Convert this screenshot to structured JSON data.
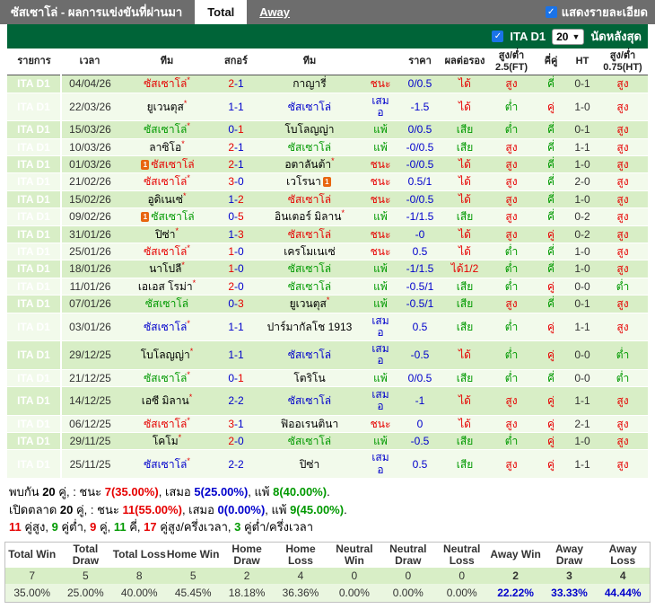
{
  "topbar": {
    "title": "ซัสเซาโล่ - ผลการแข่งขันที่ผ่านมา",
    "tabs": [
      {
        "label": "Total",
        "active": true
      },
      {
        "label": "Away",
        "active": false
      }
    ],
    "details_label": "แสดงรายละเอียด",
    "details_checked": true
  },
  "filter": {
    "league_label": "ITA D1",
    "league_checked": true,
    "match_count": "20",
    "last_matches_label": "นัดหลังสุด"
  },
  "colors": {
    "red": "#e60000",
    "blue": "#0000cc",
    "green": "#009900",
    "league_blue": "#1b7ad6",
    "bar_green": "#006438",
    "row_dark": "#d8eec6",
    "row_light": "#f2faeb",
    "topbar_gray": "#6d6d6d"
  },
  "table": {
    "headers": [
      "รายการ",
      "เวลา",
      "ทีม",
      "สกอร์",
      "ทีม",
      "",
      "ราคา",
      "ผลต่อรอง",
      "สูง/ต่ำ 2.5(FT)",
      "คี่คู่",
      "HT",
      "สูง/ต่ำ 0.75(HT)"
    ],
    "rows": [
      {
        "lg": "ITA D1",
        "dt": "04/04/26",
        "h": {
          "n": "ซัสเซาโล่",
          "c": "r",
          "s": 1
        },
        "sc": {
          "h": "2",
          "a": "1",
          "w": "h"
        },
        "a": {
          "n": "กาญารี่",
          "c": "k"
        },
        "res": {
          "t": "ชนะ",
          "c": "r"
        },
        "hdp": "0/0.5",
        "od": {
          "t": "ได้",
          "c": "r"
        },
        "ou": {
          "t": "สูง",
          "c": "r"
        },
        "oe": {
          "t": "คี่",
          "c": "g"
        },
        "ht": "0-1",
        "ou2": {
          "t": "สูง",
          "c": "r"
        }
      },
      {
        "lg": "ITA D1",
        "dt": "22/03/26",
        "h": {
          "n": "ยูเวนตุส",
          "c": "k",
          "s": 1
        },
        "sc": {
          "h": "1",
          "a": "1",
          "w": "d"
        },
        "a": {
          "n": "ซัสเซาโล่",
          "c": "b"
        },
        "res": {
          "t": "เสมอ",
          "c": "b"
        },
        "hdp": "-1.5",
        "od": {
          "t": "ได้",
          "c": "r"
        },
        "ou": {
          "t": "ต่ำ",
          "c": "g"
        },
        "oe": {
          "t": "คู่",
          "c": "r"
        },
        "ht": "1-0",
        "ou2": {
          "t": "สูง",
          "c": "r"
        }
      },
      {
        "lg": "ITA D1",
        "dt": "15/03/26",
        "h": {
          "n": "ซัสเซาโล่",
          "c": "g",
          "s": 1
        },
        "sc": {
          "h": "0",
          "a": "1",
          "w": "a"
        },
        "a": {
          "n": "โบโลญญ่า",
          "c": "k"
        },
        "res": {
          "t": "แพ้",
          "c": "g"
        },
        "hdp": "0/0.5",
        "od": {
          "t": "เสีย",
          "c": "g"
        },
        "ou": {
          "t": "ต่ำ",
          "c": "g"
        },
        "oe": {
          "t": "คี่",
          "c": "g"
        },
        "ht": "0-1",
        "ou2": {
          "t": "สูง",
          "c": "r"
        }
      },
      {
        "lg": "ITA D1",
        "dt": "10/03/26",
        "h": {
          "n": "ลาซิโอ",
          "c": "k",
          "s": 1
        },
        "sc": {
          "h": "2",
          "a": "1",
          "w": "h"
        },
        "a": {
          "n": "ซัสเซาโล่",
          "c": "g"
        },
        "res": {
          "t": "แพ้",
          "c": "g"
        },
        "hdp": "-0/0.5",
        "od": {
          "t": "เสีย",
          "c": "g"
        },
        "ou": {
          "t": "สูง",
          "c": "r"
        },
        "oe": {
          "t": "คี่",
          "c": "g"
        },
        "ht": "1-1",
        "ou2": {
          "t": "สูง",
          "c": "r"
        }
      },
      {
        "lg": "ITA D1",
        "dt": "01/03/26",
        "h": {
          "n": "ซัสเซาโล่",
          "c": "r",
          "ic": "before"
        },
        "sc": {
          "h": "2",
          "a": "1",
          "w": "h"
        },
        "a": {
          "n": "อตาลันต้า",
          "c": "k",
          "s": 1
        },
        "res": {
          "t": "ชนะ",
          "c": "r"
        },
        "hdp": "-0/0.5",
        "od": {
          "t": "ได้",
          "c": "r"
        },
        "ou": {
          "t": "สูง",
          "c": "r"
        },
        "oe": {
          "t": "คี่",
          "c": "g"
        },
        "ht": "1-0",
        "ou2": {
          "t": "สูง",
          "c": "r"
        }
      },
      {
        "lg": "ITA D1",
        "dt": "21/02/26",
        "h": {
          "n": "ซัสเซาโล่",
          "c": "r",
          "s": 1
        },
        "sc": {
          "h": "3",
          "a": "0",
          "w": "h"
        },
        "a": {
          "n": "เวโรนา",
          "c": "k",
          "ic": "after"
        },
        "res": {
          "t": "ชนะ",
          "c": "r"
        },
        "hdp": "0.5/1",
        "od": {
          "t": "ได้",
          "c": "r"
        },
        "ou": {
          "t": "สูง",
          "c": "r"
        },
        "oe": {
          "t": "คี่",
          "c": "g"
        },
        "ht": "2-0",
        "ou2": {
          "t": "สูง",
          "c": "r"
        }
      },
      {
        "lg": "ITA D1",
        "dt": "15/02/26",
        "h": {
          "n": "อูดิเนเซ่",
          "c": "k",
          "s": 1
        },
        "sc": {
          "h": "1",
          "a": "2",
          "w": "a"
        },
        "a": {
          "n": "ซัสเซาโล่",
          "c": "r"
        },
        "res": {
          "t": "ชนะ",
          "c": "r"
        },
        "hdp": "-0/0.5",
        "od": {
          "t": "ได้",
          "c": "r"
        },
        "ou": {
          "t": "สูง",
          "c": "r"
        },
        "oe": {
          "t": "คี่",
          "c": "g"
        },
        "ht": "1-0",
        "ou2": {
          "t": "สูง",
          "c": "r"
        }
      },
      {
        "lg": "ITA D1",
        "dt": "09/02/26",
        "h": {
          "n": "ซัสเซาโล่",
          "c": "g",
          "ic": "before"
        },
        "sc": {
          "h": "0",
          "a": "5",
          "w": "a"
        },
        "a": {
          "n": "อินเตอร์ มิลาน",
          "c": "k",
          "s": 1
        },
        "res": {
          "t": "แพ้",
          "c": "g"
        },
        "hdp": "-1/1.5",
        "od": {
          "t": "เสีย",
          "c": "g"
        },
        "ou": {
          "t": "สูง",
          "c": "r"
        },
        "oe": {
          "t": "คี่",
          "c": "g"
        },
        "ht": "0-2",
        "ou2": {
          "t": "สูง",
          "c": "r"
        }
      },
      {
        "lg": "ITA D1",
        "dt": "31/01/26",
        "h": {
          "n": "ปิซ่า",
          "c": "k",
          "s": 1
        },
        "sc": {
          "h": "1",
          "a": "3",
          "w": "a"
        },
        "a": {
          "n": "ซัสเซาโล่",
          "c": "r"
        },
        "res": {
          "t": "ชนะ",
          "c": "r"
        },
        "hdp": "-0",
        "od": {
          "t": "ได้",
          "c": "r"
        },
        "ou": {
          "t": "สูง",
          "c": "r"
        },
        "oe": {
          "t": "คู่",
          "c": "r"
        },
        "ht": "0-2",
        "ou2": {
          "t": "สูง",
          "c": "r"
        }
      },
      {
        "lg": "ITA D1",
        "dt": "25/01/26",
        "h": {
          "n": "ซัสเซาโล่",
          "c": "r",
          "s": 1
        },
        "sc": {
          "h": "1",
          "a": "0",
          "w": "h"
        },
        "a": {
          "n": "เครโมเนเซ่",
          "c": "k"
        },
        "res": {
          "t": "ชนะ",
          "c": "r"
        },
        "hdp": "0.5",
        "od": {
          "t": "ได้",
          "c": "r"
        },
        "ou": {
          "t": "ต่ำ",
          "c": "g"
        },
        "oe": {
          "t": "คี่",
          "c": "g"
        },
        "ht": "1-0",
        "ou2": {
          "t": "สูง",
          "c": "r"
        }
      },
      {
        "lg": "ITA D1",
        "dt": "18/01/26",
        "h": {
          "n": "นาโปลี",
          "c": "k",
          "s": 1
        },
        "sc": {
          "h": "1",
          "a": "0",
          "w": "h"
        },
        "a": {
          "n": "ซัสเซาโล่",
          "c": "g"
        },
        "res": {
          "t": "แพ้",
          "c": "g"
        },
        "hdp": "-1/1.5",
        "od": {
          "t": "ได้1/2",
          "c": "r"
        },
        "ou": {
          "t": "ต่ำ",
          "c": "g"
        },
        "oe": {
          "t": "คี่",
          "c": "g"
        },
        "ht": "1-0",
        "ou2": {
          "t": "สูง",
          "c": "r"
        }
      },
      {
        "lg": "ITA D1",
        "dt": "11/01/26",
        "h": {
          "n": "เอเอส โรม่า",
          "c": "k",
          "s": 1
        },
        "sc": {
          "h": "2",
          "a": "0",
          "w": "h"
        },
        "a": {
          "n": "ซัสเซาโล่",
          "c": "g"
        },
        "res": {
          "t": "แพ้",
          "c": "g"
        },
        "hdp": "-0.5/1",
        "od": {
          "t": "เสีย",
          "c": "g"
        },
        "ou": {
          "t": "ต่ำ",
          "c": "g"
        },
        "oe": {
          "t": "คู่",
          "c": "r"
        },
        "ht": "0-0",
        "ou2": {
          "t": "ต่ำ",
          "c": "g"
        }
      },
      {
        "lg": "ITA D1",
        "dt": "07/01/26",
        "h": {
          "n": "ซัสเซาโล่",
          "c": "g"
        },
        "sc": {
          "h": "0",
          "a": "3",
          "w": "a"
        },
        "a": {
          "n": "ยูเวนตุส",
          "c": "k",
          "s": 1
        },
        "res": {
          "t": "แพ้",
          "c": "g"
        },
        "hdp": "-0.5/1",
        "od": {
          "t": "เสีย",
          "c": "g"
        },
        "ou": {
          "t": "สูง",
          "c": "r"
        },
        "oe": {
          "t": "คี่",
          "c": "g"
        },
        "ht": "0-1",
        "ou2": {
          "t": "สูง",
          "c": "r"
        }
      },
      {
        "lg": "ITA D1",
        "dt": "03/01/26",
        "h": {
          "n": "ซัสเซาโล่",
          "c": "b",
          "s": 1
        },
        "sc": {
          "h": "1",
          "a": "1",
          "w": "d"
        },
        "a": {
          "n": "ปาร์มากัลโช 1913",
          "c": "k"
        },
        "res": {
          "t": "เสมอ",
          "c": "b"
        },
        "hdp": "0.5",
        "od": {
          "t": "เสีย",
          "c": "g"
        },
        "ou": {
          "t": "ต่ำ",
          "c": "g"
        },
        "oe": {
          "t": "คู่",
          "c": "r"
        },
        "ht": "1-1",
        "ou2": {
          "t": "สูง",
          "c": "r"
        }
      },
      {
        "lg": "ITA D1",
        "dt": "29/12/25",
        "h": {
          "n": "โบโลญญ่า",
          "c": "k",
          "s": 1
        },
        "sc": {
          "h": "1",
          "a": "1",
          "w": "d"
        },
        "a": {
          "n": "ซัสเซาโล่",
          "c": "b"
        },
        "res": {
          "t": "เสมอ",
          "c": "b"
        },
        "hdp": "-0.5",
        "od": {
          "t": "ได้",
          "c": "r"
        },
        "ou": {
          "t": "ต่ำ",
          "c": "g"
        },
        "oe": {
          "t": "คู่",
          "c": "r"
        },
        "ht": "0-0",
        "ou2": {
          "t": "ต่ำ",
          "c": "g"
        }
      },
      {
        "lg": "ITA D1",
        "dt": "21/12/25",
        "h": {
          "n": "ซัสเซาโล่",
          "c": "g",
          "s": 1
        },
        "sc": {
          "h": "0",
          "a": "1",
          "w": "a"
        },
        "a": {
          "n": "โตริโน",
          "c": "k"
        },
        "res": {
          "t": "แพ้",
          "c": "g"
        },
        "hdp": "0/0.5",
        "od": {
          "t": "เสีย",
          "c": "g"
        },
        "ou": {
          "t": "ต่ำ",
          "c": "g"
        },
        "oe": {
          "t": "คี่",
          "c": "g"
        },
        "ht": "0-0",
        "ou2": {
          "t": "ต่ำ",
          "c": "g"
        }
      },
      {
        "lg": "ITA D1",
        "dt": "14/12/25",
        "h": {
          "n": "เอซี มิลาน",
          "c": "k",
          "s": 1
        },
        "sc": {
          "h": "2",
          "a": "2",
          "w": "d"
        },
        "a": {
          "n": "ซัสเซาโล่",
          "c": "b"
        },
        "res": {
          "t": "เสมอ",
          "c": "b"
        },
        "hdp": "-1",
        "od": {
          "t": "ได้",
          "c": "r"
        },
        "ou": {
          "t": "สูง",
          "c": "r"
        },
        "oe": {
          "t": "คู่",
          "c": "r"
        },
        "ht": "1-1",
        "ou2": {
          "t": "สูง",
          "c": "r"
        }
      },
      {
        "lg": "ITA D1",
        "dt": "06/12/25",
        "h": {
          "n": "ซัสเซาโล่",
          "c": "r",
          "s": 1
        },
        "sc": {
          "h": "3",
          "a": "1",
          "w": "h"
        },
        "a": {
          "n": "ฟิออเรนตินา",
          "c": "k"
        },
        "res": {
          "t": "ชนะ",
          "c": "r"
        },
        "hdp": "0",
        "od": {
          "t": "ได้",
          "c": "r"
        },
        "ou": {
          "t": "สูง",
          "c": "r"
        },
        "oe": {
          "t": "คู่",
          "c": "r"
        },
        "ht": "2-1",
        "ou2": {
          "t": "สูง",
          "c": "r"
        }
      },
      {
        "lg": "ITA D1",
        "dt": "29/11/25",
        "h": {
          "n": "โคโม",
          "c": "k",
          "s": 1
        },
        "sc": {
          "h": "2",
          "a": "0",
          "w": "h"
        },
        "a": {
          "n": "ซัสเซาโล่",
          "c": "g"
        },
        "res": {
          "t": "แพ้",
          "c": "g"
        },
        "hdp": "-0.5",
        "od": {
          "t": "เสีย",
          "c": "g"
        },
        "ou": {
          "t": "ต่ำ",
          "c": "g"
        },
        "oe": {
          "t": "คู่",
          "c": "r"
        },
        "ht": "1-0",
        "ou2": {
          "t": "สูง",
          "c": "r"
        }
      },
      {
        "lg": "ITA D1",
        "dt": "25/11/25",
        "h": {
          "n": "ซัสเซาโล่",
          "c": "b",
          "s": 1
        },
        "sc": {
          "h": "2",
          "a": "2",
          "w": "d"
        },
        "a": {
          "n": "ปิซ่า",
          "c": "k"
        },
        "res": {
          "t": "เสมอ",
          "c": "b"
        },
        "hdp": "0.5",
        "od": {
          "t": "เสีย",
          "c": "g"
        },
        "ou": {
          "t": "สูง",
          "c": "r"
        },
        "oe": {
          "t": "คู่",
          "c": "r"
        },
        "ht": "1-1",
        "ou2": {
          "t": "สูง",
          "c": "r"
        }
      }
    ]
  },
  "summary": {
    "lines": [
      [
        {
          "t": "พบกัน ",
          "c": "k"
        },
        {
          "t": "20",
          "c": "k",
          "b": 1
        },
        {
          "t": " คู่, : ชนะ ",
          "c": "k"
        },
        {
          "t": "7(35.00%)",
          "c": "r",
          "b": 1
        },
        {
          "t": ", เสมอ ",
          "c": "k"
        },
        {
          "t": "5(25.00%)",
          "c": "b",
          "b": 1
        },
        {
          "t": ", แพ้ ",
          "c": "k"
        },
        {
          "t": "8(40.00%)",
          "c": "g",
          "b": 1
        },
        {
          "t": ".",
          "c": "k"
        }
      ],
      [
        {
          "t": "เปิดตลาด ",
          "c": "k"
        },
        {
          "t": "20",
          "c": "k",
          "b": 1
        },
        {
          "t": " คู่, : ชนะ ",
          "c": "k"
        },
        {
          "t": "11(55.00%)",
          "c": "r",
          "b": 1
        },
        {
          "t": ", เสมอ ",
          "c": "k"
        },
        {
          "t": "0(0.00%)",
          "c": "b",
          "b": 1
        },
        {
          "t": ", แพ้ ",
          "c": "k"
        },
        {
          "t": "9(45.00%)",
          "c": "g",
          "b": 1
        },
        {
          "t": ".",
          "c": "k"
        }
      ],
      [
        {
          "t": "11",
          "c": "r",
          "b": 1
        },
        {
          "t": " คู่สูง, ",
          "c": "k"
        },
        {
          "t": "9",
          "c": "g",
          "b": 1
        },
        {
          "t": " คู่ต่ำ, ",
          "c": "k"
        },
        {
          "t": "9",
          "c": "r",
          "b": 1
        },
        {
          "t": " คู่, ",
          "c": "k"
        },
        {
          "t": "11",
          "c": "g",
          "b": 1
        },
        {
          "t": " คี่, ",
          "c": "k"
        },
        {
          "t": "17",
          "c": "r",
          "b": 1
        },
        {
          "t": " คู่สูง/ครึ่งเวลา, ",
          "c": "k"
        },
        {
          "t": "3",
          "c": "g",
          "b": 1
        },
        {
          "t": " คู่ต่ำ/ครึ่งเวลา",
          "c": "k"
        }
      ]
    ]
  },
  "stats": {
    "headers": [
      "Total Win",
      "Total Draw",
      "Total Loss",
      "Home Win",
      "Home Draw",
      "Home Loss",
      "Neutral Win",
      "Neutral Draw",
      "Neutral Loss",
      "Away Win",
      "Away Draw",
      "Away Loss"
    ],
    "values": [
      "7",
      "5",
      "8",
      "5",
      "2",
      "4",
      "0",
      "0",
      "0",
      "2",
      "3",
      "4"
    ],
    "percents": [
      "35.00%",
      "25.00%",
      "40.00%",
      "45.45%",
      "18.18%",
      "36.36%",
      "0.00%",
      "0.00%",
      "0.00%",
      "22.22%",
      "33.33%",
      "44.44%"
    ],
    "highlight_from": 9
  }
}
